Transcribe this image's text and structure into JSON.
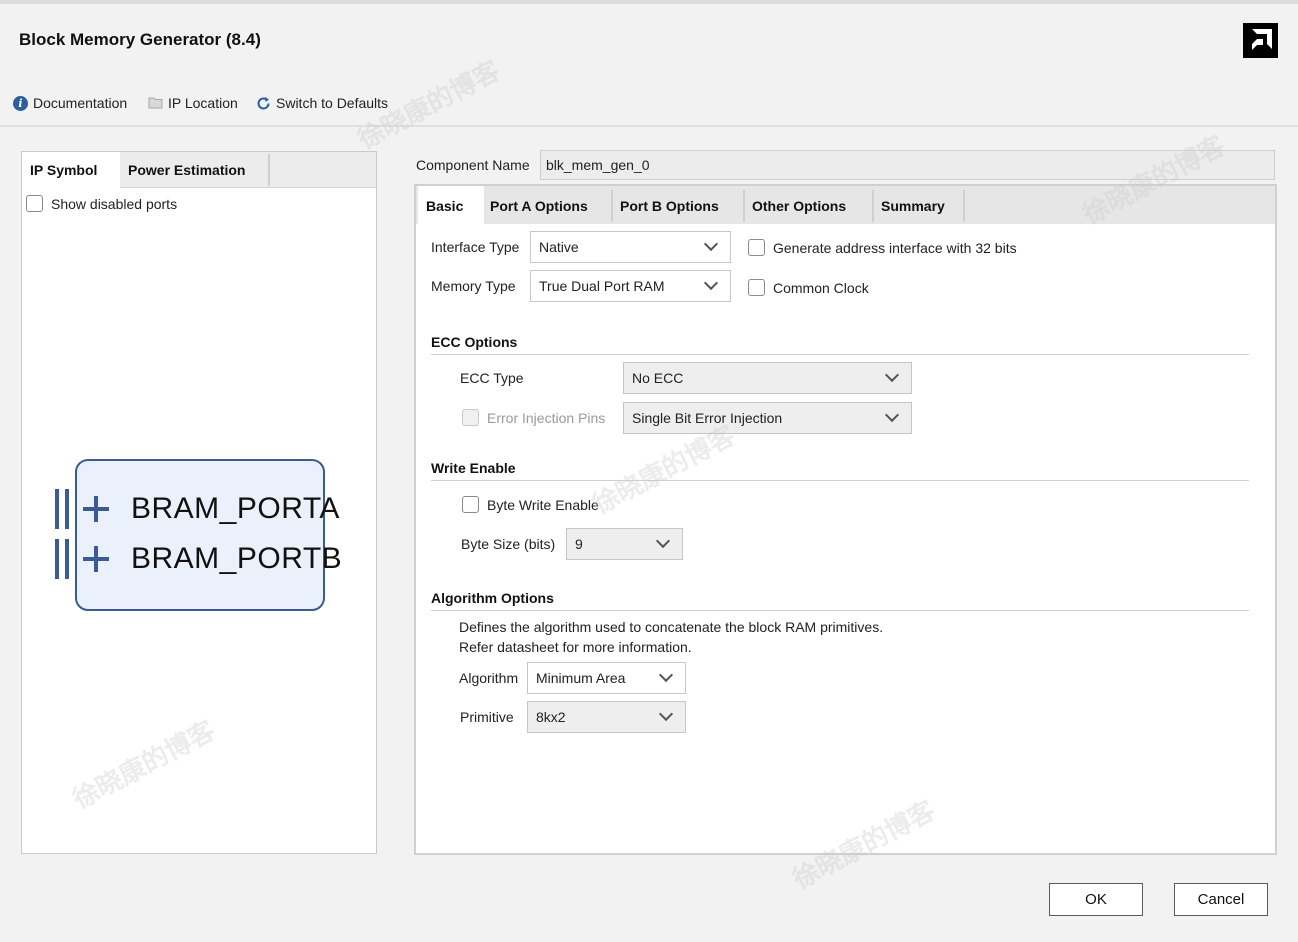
{
  "window": {
    "title": "Block Memory Generator (8.4)"
  },
  "toolbar": {
    "documentation": "Documentation",
    "ip_location": "IP Location",
    "switch_defaults": "Switch to Defaults"
  },
  "left_panel": {
    "tabs": [
      "IP Symbol",
      "Power Estimation"
    ],
    "show_disabled_ports": "Show disabled ports",
    "ports": [
      "BRAM_PORTA",
      "BRAM_PORTB"
    ]
  },
  "component": {
    "label": "Component Name",
    "value": "blk_mem_gen_0"
  },
  "tabs": [
    "Basic",
    "Port A Options",
    "Port B Options",
    "Other Options",
    "Summary"
  ],
  "basic": {
    "interface_type": {
      "label": "Interface Type",
      "value": "Native"
    },
    "memory_type": {
      "label": "Memory Type",
      "value": "True Dual Port RAM"
    },
    "gen_addr_32": "Generate address interface with 32 bits",
    "common_clock": "Common Clock",
    "ecc_options": {
      "title": "ECC Options",
      "ecc_type_label": "ECC Type",
      "ecc_type_value": "No ECC",
      "error_injection_label": "Error Injection Pins",
      "error_injection_value": "Single Bit Error Injection"
    },
    "write_enable": {
      "title": "Write Enable",
      "byte_write_enable": "Byte Write Enable",
      "byte_size_label": "Byte Size (bits)",
      "byte_size_value": "9"
    },
    "algorithm_options": {
      "title": "Algorithm Options",
      "desc1": "Defines the algorithm used to concatenate the block RAM primitives.",
      "desc2": "Refer datasheet for more information.",
      "algorithm_label": "Algorithm",
      "algorithm_value": "Minimum Area",
      "primitive_label": "Primitive",
      "primitive_value": "8kx2"
    }
  },
  "buttons": {
    "ok": "OK",
    "cancel": "Cancel"
  },
  "watermark": "徐晓康的博客",
  "colors": {
    "symbol_border": "#3c5a94",
    "symbol_fill": "#ebf1fa",
    "info_icon": "#2b5fa0"
  }
}
